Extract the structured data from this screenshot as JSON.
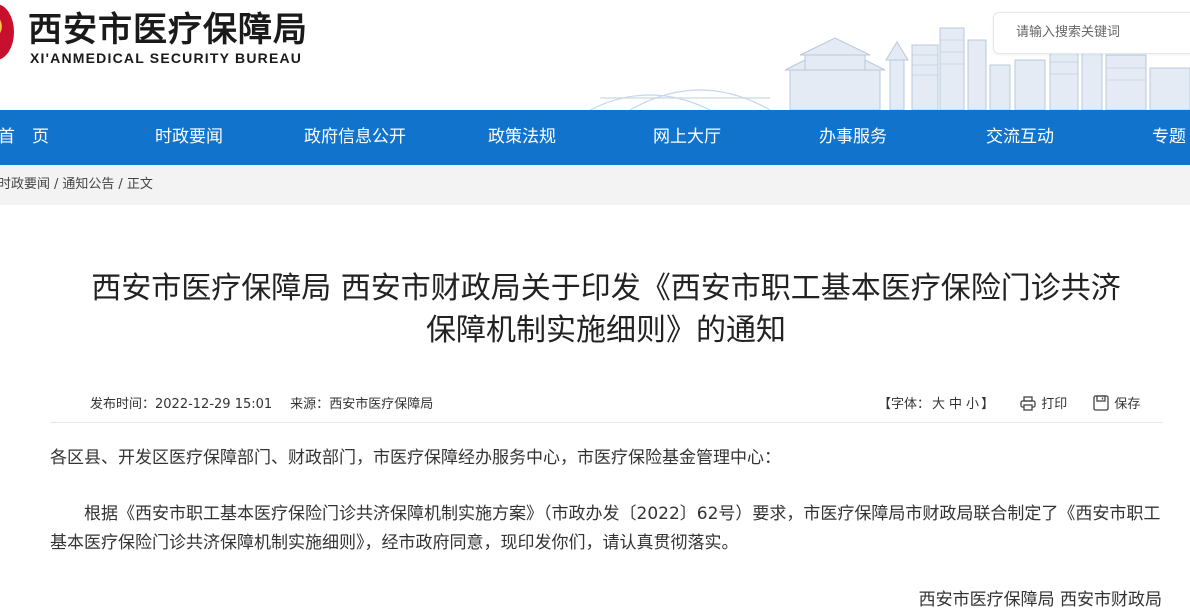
{
  "header": {
    "title": "西安市医疗保障局",
    "subtitle": "XI'ANMEDICAL SECURITY BUREAU",
    "search_placeholder": "请输入搜索关键词"
  },
  "nav": {
    "items": [
      "首　页",
      "时政要闻",
      "政府信息公开",
      "政策法规",
      "网上大厅",
      "办事服务",
      "交流互动",
      "专题"
    ]
  },
  "breadcrumb": {
    "items": [
      "时政要闻",
      "通知公告",
      "正文"
    ],
    "separator": "/"
  },
  "article": {
    "title_line1": "西安市医疗保障局 西安市财政局关于印发《西安市职工基本医疗保险门诊共济",
    "title_line2": "保障机制实施细则》的通知",
    "publish_label": "发布时间：",
    "publish_time": "2022-12-29 15:01",
    "source_label": "来源：",
    "source": "西安市医疗保障局",
    "font_prefix": "【字体：",
    "font_large": "大",
    "font_medium": "中",
    "font_small": "小",
    "font_suffix": "】",
    "print_label": "打印",
    "save_label": "保存",
    "para1": "各区县、开发区医疗保障部门、财政部门，市医疗保障经办服务中心，市医疗保险基金管理中心：",
    "para2": "根据《西安市职工基本医疗保险门诊共济保障机制实施方案》（市政办发〔2022〕62号）要求，市医疗保障局市财政局联合制定了《西安市职工基本医疗保险门诊共济保障机制实施细则》，经市政府同意，现印发你们，请认真贯彻落实。",
    "para3_partial": "西安市医疗保障局 西安市财政局"
  },
  "colors": {
    "nav_bg": "#1173cb",
    "crumb_bg": "#f3f3f3"
  }
}
